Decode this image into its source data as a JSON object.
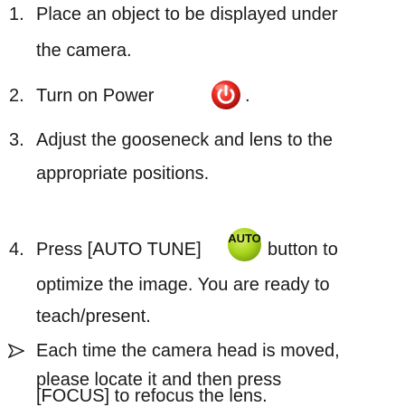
{
  "steps": [
    {
      "number": "1.",
      "lines": [
        "Place an object to be displayed under",
        "the camera."
      ]
    },
    {
      "number": "2.",
      "text_before": "Turn on Power",
      "icon": "power-button-icon",
      "text_after": "."
    },
    {
      "number": "3.",
      "lines": [
        "Adjust the gooseneck and lens to the",
        "appropriate positions."
      ]
    },
    {
      "number": "4.",
      "text_before": "Press [AUTO TUNE]",
      "icon": "auto-button-icon",
      "icon_text": "AUTO",
      "text_after": "button to",
      "lines_more": [
        "optimize the image. You are ready to",
        "teach/present."
      ]
    }
  ],
  "note": {
    "bullet_icon": "arrow-bullet-icon",
    "lines": [
      "Each time the camera head is moved,",
      "please locate it and then press",
      "[FOCUS] to refocus the lens."
    ]
  },
  "colors": {
    "power_red": "#e8261f",
    "auto_green": "#a6d31a",
    "text": "#1a1a1a"
  }
}
